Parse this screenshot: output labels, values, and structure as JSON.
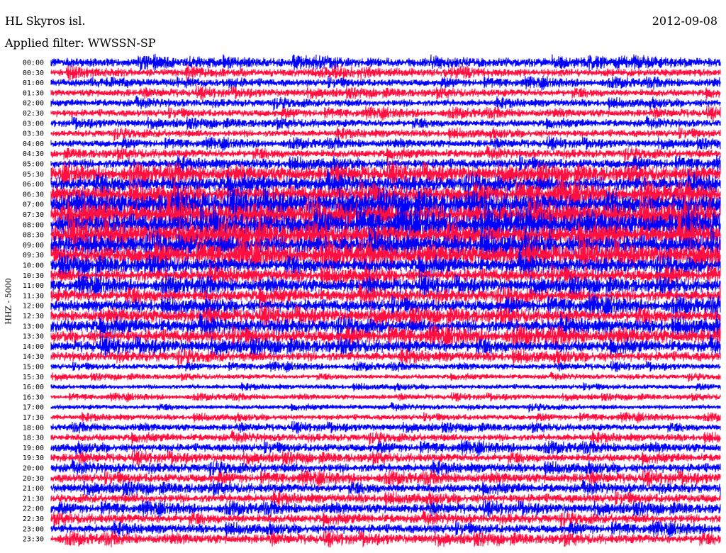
{
  "header": {
    "station": "HL Skyros isl.",
    "date": "2012-09-08",
    "filter": "Applied filter: WWSSN-SP"
  },
  "chart_data": {
    "type": "line",
    "title": "HL Skyros isl.",
    "subtitle": "Applied filter: WWSSN-SP",
    "date": "2012-09-08",
    "ylabel": "HHZ - 5000",
    "xlabel": "",
    "row_labels": [
      "00:00",
      "00:30",
      "01:00",
      "01:30",
      "02:00",
      "02:30",
      "03:00",
      "03:30",
      "04:00",
      "04:30",
      "05:00",
      "05:30",
      "06:00",
      "06:30",
      "07:00",
      "07:30",
      "08:00",
      "08:30",
      "09:00",
      "09:30",
      "10:00",
      "10:30",
      "11:00",
      "11:30",
      "12:00",
      "12:30",
      "13:00",
      "13:30",
      "14:00",
      "14:30",
      "15:00",
      "15:30",
      "16:00",
      "16:30",
      "17:00",
      "17:30",
      "18:00",
      "18:30",
      "19:00",
      "19:30",
      "20:00",
      "20:30",
      "21:00",
      "21:30",
      "22:00",
      "22:30",
      "23:00",
      "23:30"
    ],
    "relative_amplitude": [
      0.55,
      0.5,
      0.45,
      0.45,
      0.45,
      0.45,
      0.45,
      0.45,
      0.45,
      0.5,
      0.6,
      0.85,
      0.9,
      1.0,
      1.2,
      1.3,
      1.3,
      1.2,
      1.15,
      1.1,
      0.85,
      0.8,
      0.75,
      0.75,
      0.75,
      0.75,
      0.8,
      0.8,
      0.7,
      0.6,
      0.35,
      0.3,
      0.3,
      0.3,
      0.3,
      0.35,
      0.4,
      0.45,
      0.5,
      0.5,
      0.55,
      0.55,
      0.55,
      0.55,
      0.55,
      0.55,
      0.55,
      0.55
    ],
    "series_colors": [
      "#0000ff",
      "#ff1040"
    ],
    "grid": false
  }
}
